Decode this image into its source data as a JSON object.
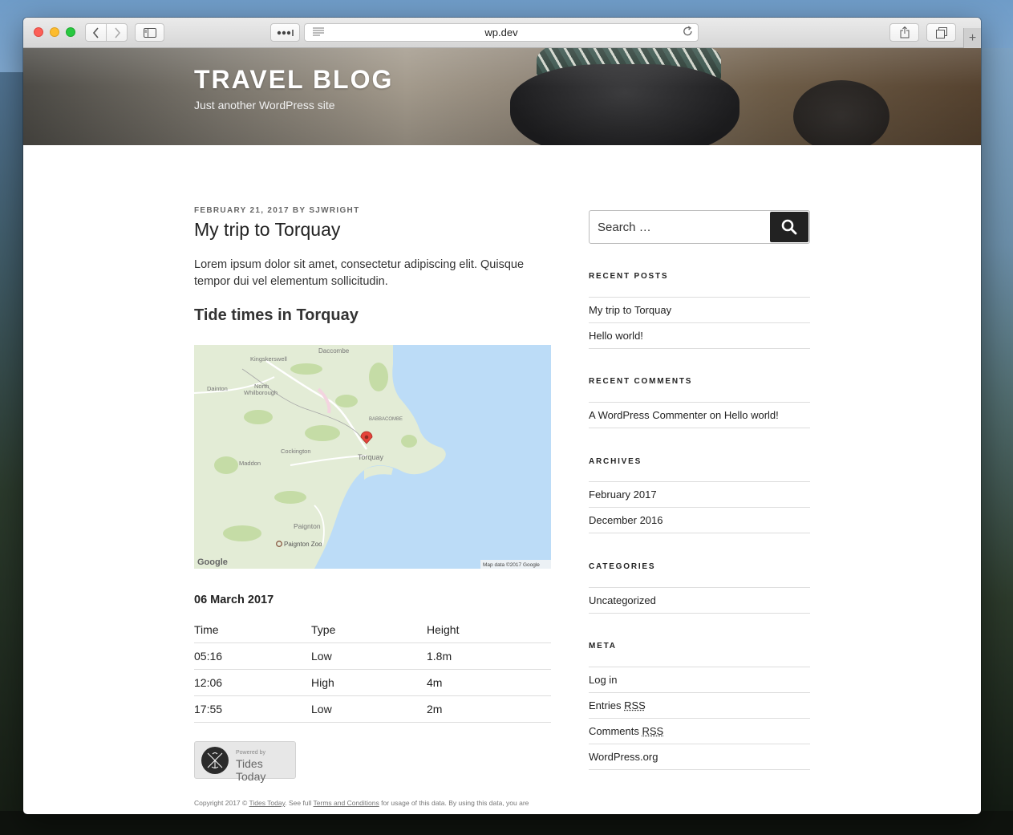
{
  "browser": {
    "url": "wp.dev",
    "icons": [
      "back-icon",
      "forward-icon",
      "sidebar-icon",
      "extensions-icon",
      "reader-icon",
      "reload-icon",
      "share-icon",
      "tabs-icon",
      "new-tab-icon"
    ]
  },
  "site": {
    "title": "TRAVEL BLOG",
    "description": "Just another WordPress site"
  },
  "post": {
    "date": "FEBRUARY 21, 2017",
    "by": "BY",
    "author": "SJWRIGHT",
    "title": "My trip to Torquay",
    "excerpt": "Lorem ipsum dolor sit amet, consectetur adipiscing elit. Quisque tempor dui vel elementum sollicitudin.",
    "tide_heading": "Tide times in Torquay"
  },
  "map": {
    "labels": {
      "daccombe": "Daccombe",
      "kingskerswell": "Kingskerswell",
      "dainton": "Dainton",
      "north_whilborough_1": "North",
      "north_whilborough_2": "Whilborough",
      "babbacombe": "BABBACOMBE",
      "cockington": "Cockington",
      "torquay": "Torquay",
      "maddon": "Maddon",
      "paignton": "Paignton",
      "paignton_zoo": "Paignton Zoo",
      "google": "Google",
      "map_data": "Map data ©2017 Google"
    },
    "colors": {
      "sea": "#bcdcf7",
      "land": "#e3ecd6",
      "green": "#c5dca6",
      "road": "#ffffff",
      "pin": "#e5433a"
    }
  },
  "tides": {
    "date": "06 March 2017",
    "headers": [
      "Time",
      "Type",
      "Height"
    ],
    "rows": [
      [
        "05:16",
        "Low",
        "1.8m"
      ],
      [
        "12:06",
        "High",
        "4m"
      ],
      [
        "17:55",
        "Low",
        "2m"
      ]
    ]
  },
  "powered": {
    "by": "Powered by",
    "name": "Tides Today"
  },
  "copyright": {
    "prefix": "Copyright 2017 ©",
    "link1": "Tides Today",
    "middle": ". See full",
    "link2": "Terms and Conditions",
    "suffix": "for usage of this data. By using this data, you are"
  },
  "sidebar": {
    "search_placeholder": "Search …",
    "recent_posts": {
      "title": "RECENT POSTS",
      "items": [
        "My trip to Torquay",
        "Hello world!"
      ]
    },
    "recent_comments": {
      "title": "RECENT COMMENTS",
      "author": "A WordPress Commenter",
      "on": "on",
      "post": "Hello world!"
    },
    "archives": {
      "title": "ARCHIVES",
      "items": [
        "February 2017",
        "December 2016"
      ]
    },
    "categories": {
      "title": "CATEGORIES",
      "items": [
        "Uncategorized"
      ]
    },
    "meta": {
      "title": "META",
      "login": "Log in",
      "entries": "Entries",
      "comments": "Comments",
      "rss": "RSS",
      "wordpress": "WordPress.org"
    }
  }
}
